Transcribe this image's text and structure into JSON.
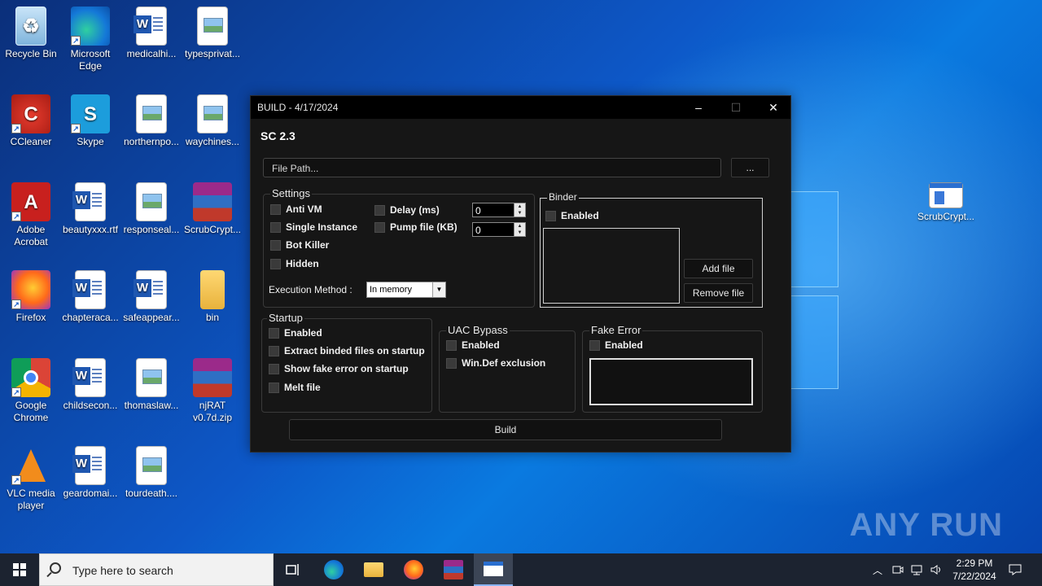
{
  "desktop": {
    "icons": [
      {
        "label": "Recycle Bin",
        "icon": "recycle-bin-icon"
      },
      {
        "label": "Microsoft Edge",
        "icon": "edge-icon"
      },
      {
        "label": "medicalhi...",
        "icon": "word-document-icon"
      },
      {
        "label": "typesprivat...",
        "icon": "image-file-icon"
      },
      {
        "label": "CCleaner",
        "icon": "ccleaner-icon"
      },
      {
        "label": "Skype",
        "icon": "skype-icon"
      },
      {
        "label": "northernpo...",
        "icon": "image-file-icon"
      },
      {
        "label": "waychines...",
        "icon": "image-file-icon"
      },
      {
        "label": "Adobe Acrobat",
        "icon": "acrobat-icon"
      },
      {
        "label": "beautyxxx.rtf",
        "icon": "word-document-icon"
      },
      {
        "label": "responseal...",
        "icon": "image-file-icon"
      },
      {
        "label": "ScrubCrypt...",
        "icon": "winrar-archive-icon"
      },
      {
        "label": "Firefox",
        "icon": "firefox-icon"
      },
      {
        "label": "chapteraca...",
        "icon": "word-document-icon"
      },
      {
        "label": "safeappear...",
        "icon": "word-document-icon"
      },
      {
        "label": "bin",
        "icon": "folder-icon"
      },
      {
        "label": "Google Chrome",
        "icon": "chrome-icon"
      },
      {
        "label": "childsecon...",
        "icon": "word-document-icon"
      },
      {
        "label": "thomaslaw...",
        "icon": "image-file-icon"
      },
      {
        "label": "njRAT v0.7d.zip",
        "icon": "winrar-archive-icon"
      },
      {
        "label": "VLC media player",
        "icon": "vlc-icon"
      },
      {
        "label": "geardomai...",
        "icon": "word-document-icon"
      },
      {
        "label": "tourdeath....",
        "icon": "image-file-icon"
      },
      {
        "label": "ScrubCrypt...",
        "icon": "application-icon"
      }
    ],
    "watermark": "ANY RUN"
  },
  "window": {
    "title": "BUILD - 4/17/2024",
    "controls": {
      "minimize": "–",
      "maximize": "☐",
      "close": "✕"
    },
    "app_heading": "SC 2.3",
    "file_path": {
      "placeholder": "File Path...",
      "browse_label": "..."
    },
    "settings": {
      "legend": "Settings",
      "anti_vm": "Anti VM",
      "single_instance": "Single Instance",
      "bot_killer": "Bot Killer",
      "hidden": "Hidden",
      "delay_label": "Delay (ms)",
      "delay_value": "0",
      "pump_label": "Pump file (KB)",
      "pump_value": "0",
      "execution_label": "Execution Method :",
      "execution_value": "In memory"
    },
    "binder": {
      "legend": "Binder",
      "enabled": "Enabled",
      "add_file": "Add file",
      "remove_file": "Remove file"
    },
    "startup": {
      "legend": "Startup",
      "enabled": "Enabled",
      "extract": "Extract binded files on startup",
      "fake_error": "Show fake error on startup",
      "melt": "Melt file"
    },
    "uac": {
      "legend": "UAC Bypass",
      "enabled": "Enabled",
      "windef": "Win.Def exclusion"
    },
    "fake_error": {
      "legend": "Fake Error",
      "enabled": "Enabled"
    },
    "build_label": "Build"
  },
  "taskbar": {
    "search_placeholder": "Type here to search",
    "time": "2:29 PM",
    "date": "7/22/2024",
    "apps": [
      "task-view-icon",
      "edge-icon",
      "file-explorer-icon",
      "firefox-icon",
      "winrar-icon",
      "scrubcrypt-app-icon"
    ]
  }
}
